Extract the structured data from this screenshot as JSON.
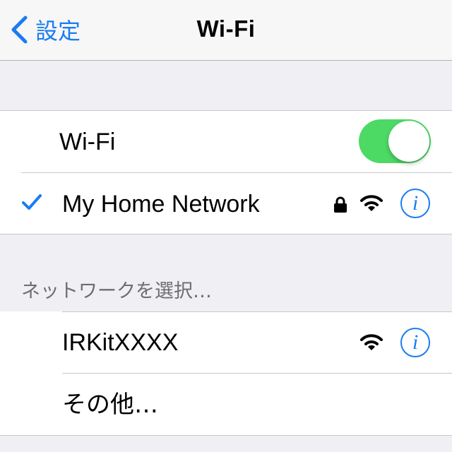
{
  "navbar": {
    "back_label": "設定",
    "title": "Wi-Fi"
  },
  "wifi_group": {
    "toggle_label": "Wi-Fi",
    "toggle_on": true,
    "connected_network": "My Home Network"
  },
  "networks_section": {
    "header": "ネットワークを選択…",
    "items": [
      {
        "label": "IRKitXXXX"
      },
      {
        "label": "その他…"
      }
    ]
  },
  "colors": {
    "accent": "#1a7cf2",
    "toggle_on": "#4cd964",
    "background": "#efeff4"
  },
  "icons": [
    "chevron-left-icon",
    "checkmark-icon",
    "lock-icon",
    "wifi-signal-icon",
    "info-icon"
  ]
}
